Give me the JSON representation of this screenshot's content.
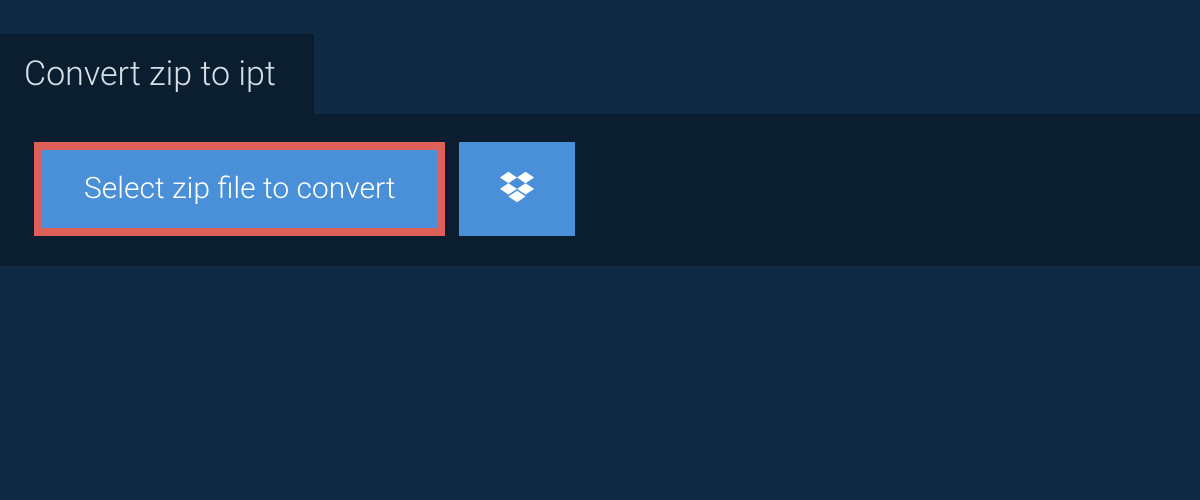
{
  "header": {
    "title": "Convert zip to ipt"
  },
  "actions": {
    "select_file_label": "Select zip file to convert"
  }
}
